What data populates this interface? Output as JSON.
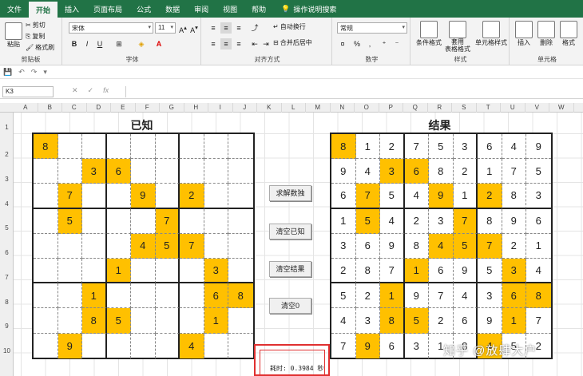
{
  "ribbon_tabs": [
    "文件",
    "开始",
    "插入",
    "页面布局",
    "公式",
    "数据",
    "审阅",
    "视图",
    "帮助"
  ],
  "active_tab": "开始",
  "tell_me": "操作说明搜索",
  "clipboard": {
    "paste": "粘贴",
    "cut": "剪切",
    "copy": "复制",
    "format_painter": "格式刷",
    "label": "剪贴板"
  },
  "font": {
    "name": "宋体",
    "size": "11",
    "label": "字体",
    "bold": "B",
    "italic": "I",
    "underline": "U"
  },
  "alignment": {
    "wrap": "自动换行",
    "merge": "合并后居中",
    "label": "对齐方式"
  },
  "number": {
    "format": "常规",
    "label": "数字",
    "percent": "%"
  },
  "styles": {
    "cond": "条件格式",
    "table": "套用\n表格格式",
    "cell": "单元格样式",
    "label": "样式"
  },
  "cells": {
    "insert": "插入",
    "delete": "删除",
    "format": "格式",
    "label": "单元格"
  },
  "name_box": "K3",
  "fx": "fx",
  "columns": [
    "A",
    "B",
    "C",
    "D",
    "E",
    "F",
    "G",
    "H",
    "I",
    "J",
    "K",
    "L",
    "M",
    "N",
    "O",
    "P",
    "Q",
    "R",
    "S",
    "T",
    "U",
    "V",
    "W",
    "X"
  ],
  "rows": [
    "1",
    "2",
    "3",
    "4",
    "5",
    "6",
    "7",
    "8",
    "9",
    "10"
  ],
  "titles": {
    "known": "已知",
    "result": "结果"
  },
  "known_grid": [
    [
      "8",
      "",
      "",
      "",
      "",
      "",
      "",
      "",
      ""
    ],
    [
      "",
      "",
      "3",
      "6",
      "",
      "",
      "",
      "",
      ""
    ],
    [
      "",
      "7",
      "",
      "",
      "9",
      "",
      "2",
      "",
      ""
    ],
    [
      "",
      "5",
      "",
      "",
      "",
      "7",
      "",
      "",
      ""
    ],
    [
      "",
      "",
      "",
      "",
      "4",
      "5",
      "7",
      "",
      ""
    ],
    [
      "",
      "",
      "",
      "1",
      "",
      "",
      "",
      "3",
      ""
    ],
    [
      "",
      "",
      "1",
      "",
      "",
      "",
      "",
      "6",
      "8"
    ],
    [
      "",
      "",
      "8",
      "5",
      "",
      "",
      "",
      "1",
      ""
    ],
    [
      "",
      "9",
      "",
      "",
      "",
      "",
      "4",
      "",
      ""
    ]
  ],
  "result_grid": [
    [
      "8",
      "1",
      "2",
      "7",
      "5",
      "3",
      "6",
      "4",
      "9"
    ],
    [
      "9",
      "4",
      "3",
      "6",
      "8",
      "2",
      "1",
      "7",
      "5"
    ],
    [
      "6",
      "7",
      "5",
      "4",
      "9",
      "1",
      "2",
      "8",
      "3"
    ],
    [
      "1",
      "5",
      "4",
      "2",
      "3",
      "7",
      "8",
      "9",
      "6"
    ],
    [
      "3",
      "6",
      "9",
      "8",
      "4",
      "5",
      "7",
      "2",
      "1"
    ],
    [
      "2",
      "8",
      "7",
      "1",
      "6",
      "9",
      "5",
      "3",
      "4"
    ],
    [
      "5",
      "2",
      "1",
      "9",
      "7",
      "4",
      "3",
      "6",
      "8"
    ],
    [
      "4",
      "3",
      "8",
      "5",
      "2",
      "6",
      "9",
      "1",
      "7"
    ],
    [
      "7",
      "9",
      "6",
      "3",
      "1",
      "8",
      "4",
      "5",
      "2"
    ]
  ],
  "buttons": {
    "solve": "求解数独",
    "clear_known": "清空已知",
    "clear_result": "清空结果",
    "clear_zero": "清空0"
  },
  "timer": "耗时: 0.3984 秒",
  "watermark": "知乎 @放肆大户",
  "colors": {
    "excel_green": "#217346",
    "highlight": "#ffc000",
    "timer_border": "#e03030"
  }
}
